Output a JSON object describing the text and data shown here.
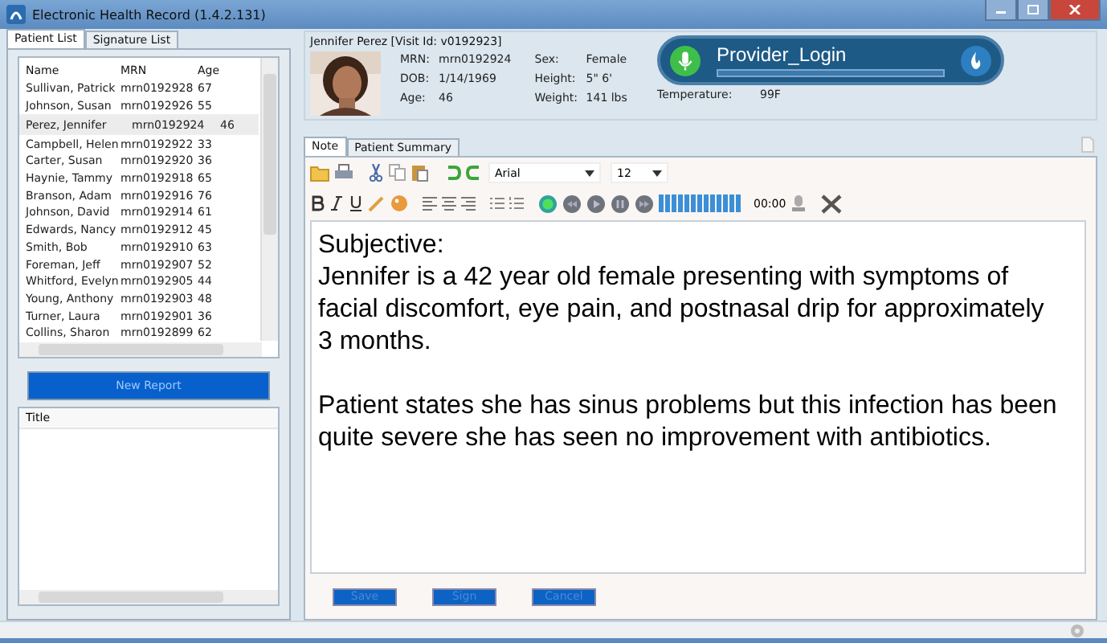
{
  "window": {
    "title": "Electronic Health Record (1.4.2.131)"
  },
  "patient_list": {
    "tabs": [
      {
        "label": "Patient List",
        "selected": true
      },
      {
        "label": "Signature List",
        "selected": false
      }
    ],
    "columns": [
      "Name",
      "MRN",
      "Age"
    ],
    "rows": [
      {
        "name": "Sullivan, Patrick",
        "mrn": "mrn0192928",
        "age": "67",
        "selected": false
      },
      {
        "name": "Johnson, Susan",
        "mrn": "mrn0192926",
        "age": "55",
        "selected": false
      },
      {
        "name": "Perez, Jennifer",
        "mrn": "mrn0192924",
        "age": "46",
        "selected": true
      },
      {
        "name": "Campbell, Helen",
        "mrn": "mrn0192922",
        "age": "33",
        "selected": false
      },
      {
        "name": "Carter, Susan",
        "mrn": "mrn0192920",
        "age": "36",
        "selected": false
      },
      {
        "name": "Haynie, Tammy",
        "mrn": "mrn0192918",
        "age": "65",
        "selected": false
      },
      {
        "name": "Branson, Adam",
        "mrn": "mrn0192916",
        "age": "76",
        "selected": false
      },
      {
        "name": "Johnson, David",
        "mrn": "mrn0192914",
        "age": "61",
        "selected": false
      },
      {
        "name": "Edwards, Nancy",
        "mrn": "mrn0192912",
        "age": "45",
        "selected": false
      },
      {
        "name": "Smith, Bob",
        "mrn": "mrn0192910",
        "age": "63",
        "selected": false
      },
      {
        "name": "Foreman, Jeff",
        "mrn": "mrn0192907",
        "age": "52",
        "selected": false
      },
      {
        "name": "Whitford, Evelyn",
        "mrn": "mrn0192905",
        "age": "44",
        "selected": false
      },
      {
        "name": "Young, Anthony",
        "mrn": "mrn0192903",
        "age": "48",
        "selected": false
      },
      {
        "name": "Turner, Laura",
        "mrn": "mrn0192901",
        "age": "36",
        "selected": false
      },
      {
        "name": "Collins, Sharon",
        "mrn": "mrn0192899",
        "age": "62",
        "selected": false
      }
    ]
  },
  "new_report_button": "New Report",
  "reports": {
    "columns": [
      "Title"
    ]
  },
  "patient_header": {
    "heading": "Jennifer Perez [Visit Id: v0192923]",
    "fields": [
      {
        "label": "MRN:",
        "value": "mrn0192924"
      },
      {
        "label": "Sex:",
        "value": "Female"
      },
      {
        "label": "DOB:",
        "value": "1/14/1969"
      },
      {
        "label": "Height:",
        "value": "5\" 6'"
      },
      {
        "label": "Age:",
        "value": "46"
      },
      {
        "label": "Weight:",
        "value": "141 lbs"
      }
    ],
    "temperature": {
      "label": "Temperature:",
      "value": "99F"
    }
  },
  "dictation": {
    "user": "Provider_Login"
  },
  "note_tabs": [
    {
      "label": "Note",
      "selected": true
    },
    {
      "label": "Patient Summary",
      "selected": false
    }
  ],
  "toolbar": {
    "font": "Arial",
    "size": "12",
    "timer": "00:00"
  },
  "note": {
    "sections": [
      {
        "lines": [
          "Subjective:",
          "Jennifer is a 42 year old female presenting with symptoms of",
          "facial discomfort, eye pain, and postnasal drip for approximately",
          "3 months."
        ]
      },
      {
        "lines": [
          "Patient states she has sinus problems but this infection has been",
          "quite severe she has seen no improvement with antibiotics."
        ]
      }
    ]
  },
  "buttons": [
    "Save",
    "Sign",
    "Cancel"
  ]
}
